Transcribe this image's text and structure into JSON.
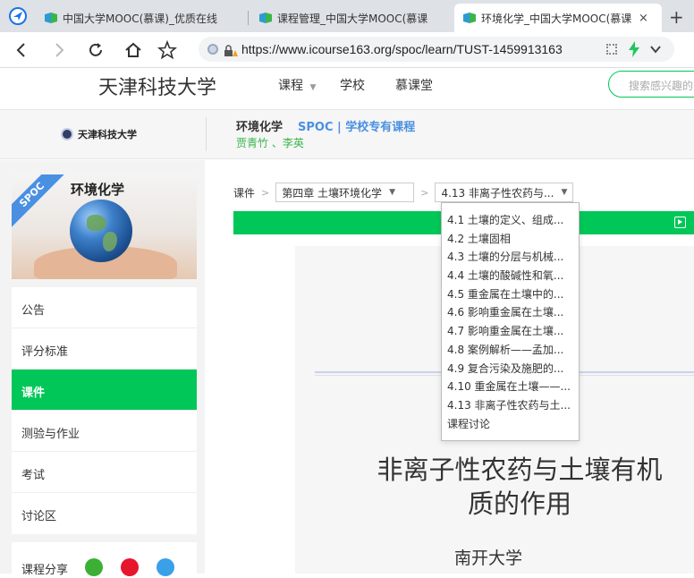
{
  "browser": {
    "tabs": [
      {
        "label": "中国大学MOOC(慕课)_优质在线"
      },
      {
        "label": "课程管理_中国大学MOOC(慕课"
      },
      {
        "label": "环境化学_中国大学MOOC(慕课",
        "close": "×",
        "active": true
      }
    ],
    "new_tab": "+",
    "url": "https://www.icourse163.org/spoc/learn/TUST-1459913163"
  },
  "site": {
    "school_title": "天津科技大学",
    "nav": [
      "课程",
      "学校",
      "慕课堂"
    ],
    "search_placeholder": "搜索感兴趣的"
  },
  "course_header": {
    "logo_text": "天津科技大学",
    "course_name": "环境化学",
    "spoc_label": "SPOC | 学校专有课程",
    "teachers": "贾青竹 、李英"
  },
  "course_card": {
    "title": "环境化学",
    "ribbon": "SPOC"
  },
  "menu": [
    {
      "label": "公告"
    },
    {
      "label": "评分标准"
    },
    {
      "label": "课件",
      "active": true
    },
    {
      "label": "测验与作业"
    },
    {
      "label": "考试"
    },
    {
      "label": "讨论区"
    }
  ],
  "share": {
    "label": "课程分享"
  },
  "breadcrumb": {
    "root": "课件",
    "chapter": "第四章 土壤环境化学",
    "section": "4.13 非离子性农药与..."
  },
  "dropdown_items": [
    "4.1 土壤的定义、组成...",
    "4.2 土壤固相",
    "4.3 土壤的分层与机械...",
    "4.4 土壤的酸碱性和氧...",
    "4.5 重金属在土壤中的...",
    "4.6 影响重金属在土壤...",
    "4.7 影响重金属在土壤...",
    "4.8 案例解析——孟加...",
    "4.9 复合污染及施肥的...",
    "4.10 重金属在土壤——...",
    "4.13 非离子性农药与土...",
    "课程讨论"
  ],
  "slide": {
    "title": "非离子性农药与土壤有机质的作用",
    "title_line1": "非离子性农药与土壤有机",
    "title_line2": "质的作用",
    "subtitle": "南开大学"
  },
  "colors": {
    "accent": "#00c758",
    "spoc_blue": "#4a90e2",
    "teacher_green": "#39b54a"
  }
}
